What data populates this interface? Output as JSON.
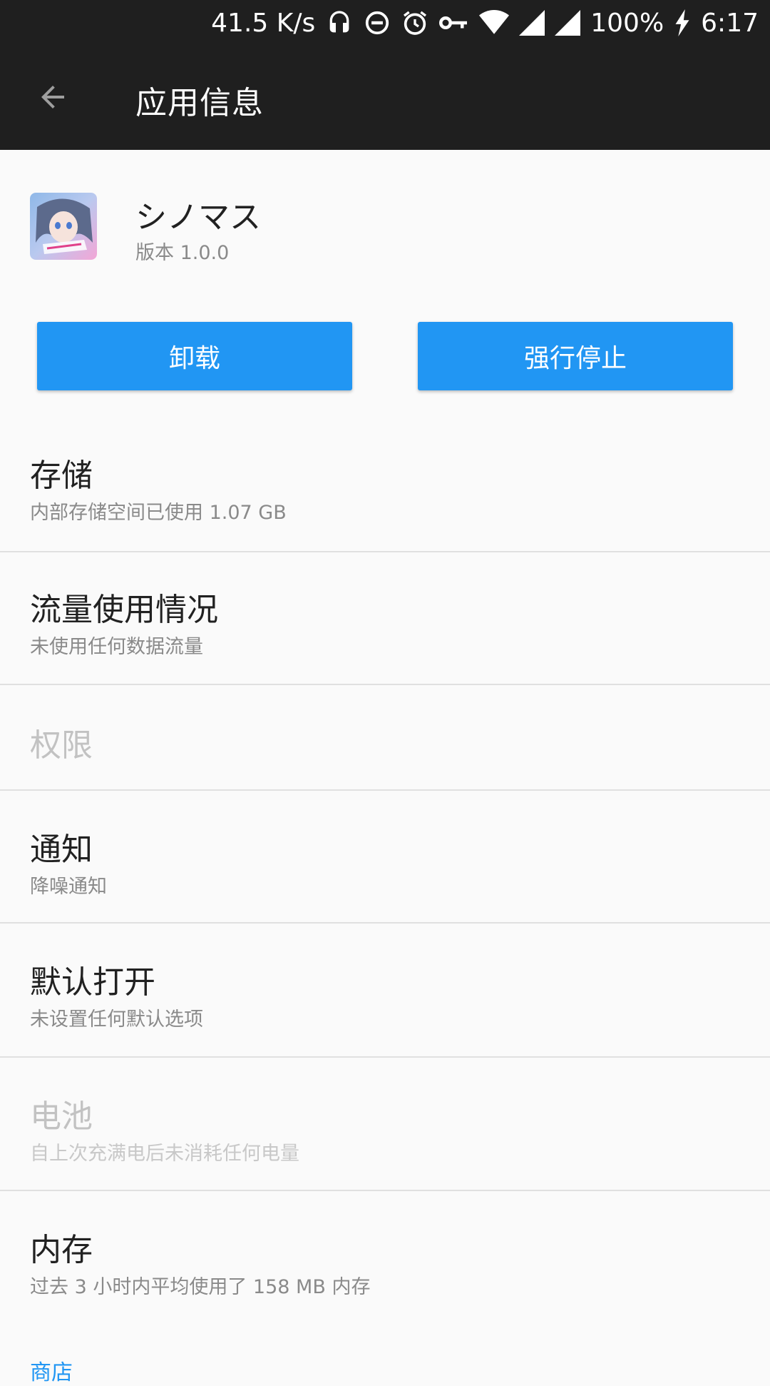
{
  "status_bar": {
    "net_speed": "41.5 K/s",
    "battery": "100%",
    "time": "6:17",
    "icons": [
      "headset-icon",
      "dnd-icon",
      "alarm-icon",
      "vpn-key-icon",
      "wifi-icon",
      "signal-icon",
      "signal-icon",
      "charging-icon"
    ]
  },
  "app_bar": {
    "title": "应用信息",
    "back_icon": "arrow-back-icon"
  },
  "app": {
    "name": "シノマス",
    "version": "版本 1.0.0"
  },
  "buttons": {
    "uninstall": "卸载",
    "force_stop": "强行停止",
    "color": "#2196f3"
  },
  "items": [
    {
      "title": "存储",
      "subtitle": "内部存储空间已使用 1.07 GB",
      "enabled": true
    },
    {
      "title": "流量使用情况",
      "subtitle": "未使用任何数据流量",
      "enabled": true
    },
    {
      "title": "权限",
      "subtitle": "",
      "enabled": false
    },
    {
      "title": "通知",
      "subtitle": "降噪通知",
      "enabled": true
    },
    {
      "title": "默认打开",
      "subtitle": "未设置任何默认选项",
      "enabled": true
    },
    {
      "title": "电池",
      "subtitle": "自上次充满电后未消耗任何电量",
      "enabled": false
    },
    {
      "title": "内存",
      "subtitle": "过去 3 小时内平均使用了 158 MB 内存",
      "enabled": true
    }
  ],
  "store_section": {
    "label": "商店"
  }
}
